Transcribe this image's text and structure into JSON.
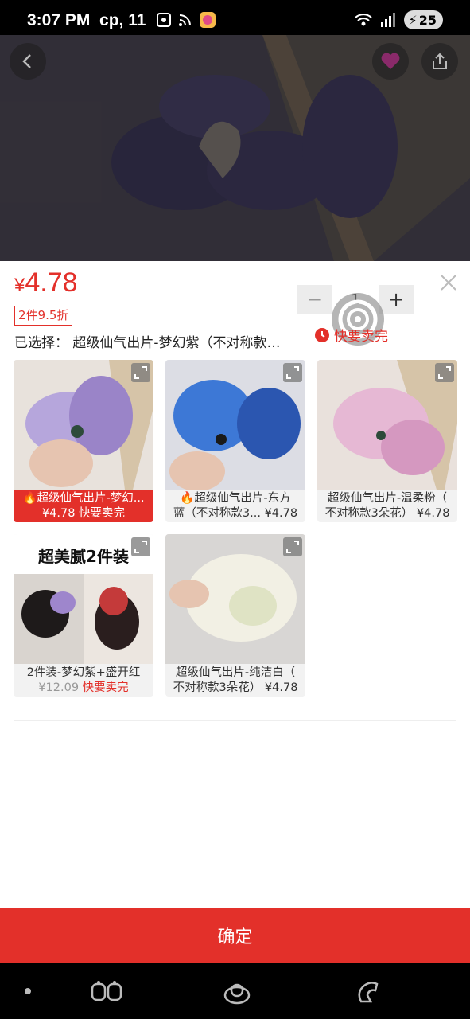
{
  "status": {
    "time": "3:07 PM",
    "date": "ср, 11",
    "battery": "25"
  },
  "header": {
    "back_icon": "chevron-left-icon",
    "fav_icon": "heart-icon",
    "share_icon": "share-icon"
  },
  "product": {
    "currency": "¥",
    "price": "4.78",
    "discount": "2件9.5折",
    "selected_label": "已选择：",
    "selected_value": "超级仙气出片-梦幻紫（不对称款…",
    "quantity": "1",
    "minus": "−",
    "plus": "+",
    "selling_fast": "快要卖完"
  },
  "variants": [
    {
      "line1": "超级仙气出片-梦幻...",
      "line2_price": "¥4.78",
      "line2_tag": "快要卖完",
      "hot": true,
      "active": true,
      "img_colors": [
        "#b6a6dc",
        "#9a84c8",
        "#e8e2dc"
      ]
    },
    {
      "line1": "超级仙气出片-东方",
      "line2_price": "¥4.78",
      "line2_text": "蓝（不对称款3...",
      "hot": true,
      "active": false,
      "img_colors": [
        "#3d78d6",
        "#2b56b0",
        "#dcdde4"
      ]
    },
    {
      "line1": "超级仙气出片-温柔粉（",
      "line2_text": "不对称款3朵花）",
      "line2_price": "¥4.78",
      "active": false,
      "img_colors": [
        "#e6b8d4",
        "#d598c0",
        "#e9e1dc"
      ]
    },
    {
      "banner": "超美腻2件装",
      "line1": "2件装-梦幻紫+盛开红",
      "line2_price": "¥12.09",
      "line2_tag": "快要卖完",
      "active": false,
      "img_colors": [
        "#c43a3a",
        "#9e86cc",
        "#f2f2f2"
      ]
    },
    {
      "line1": "超级仙气出片-纯洁白（",
      "line2_text": "不对称款3朵花）",
      "line2_price": "¥4.78",
      "active": false,
      "img_colors": [
        "#f2f0e4",
        "#dfe3c4",
        "#d8d6d4"
      ]
    }
  ],
  "confirm_label": "确定",
  "colors": {
    "accent": "#e3302a"
  }
}
